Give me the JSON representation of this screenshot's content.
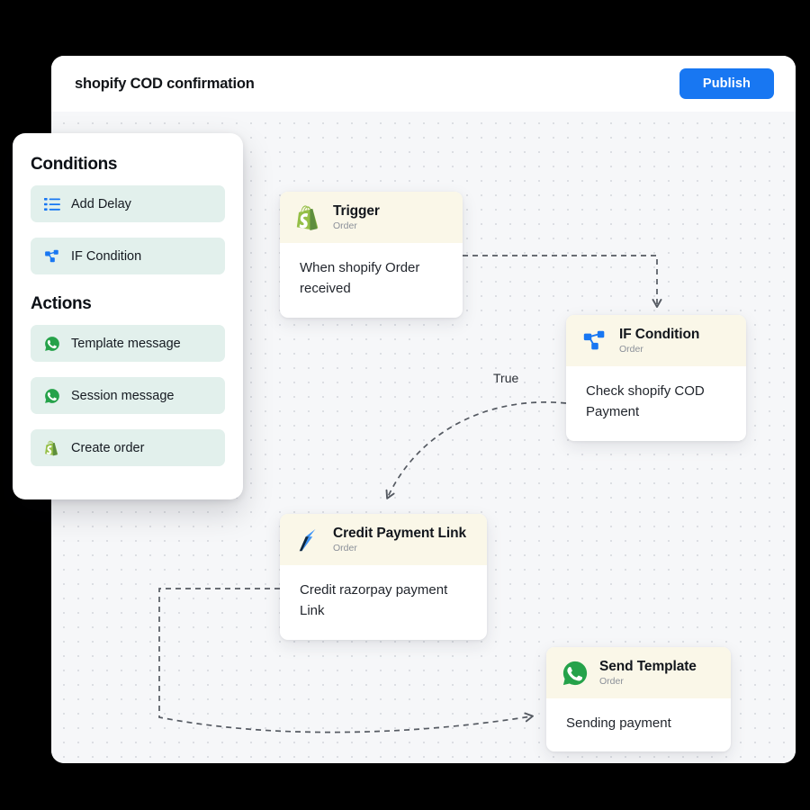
{
  "window": {
    "title": "shopify COD confirmation",
    "publish_label": "Publish"
  },
  "sidebar": {
    "sections": [
      {
        "heading": "Conditions",
        "items": [
          {
            "label": "Add Delay",
            "icon": "list-icon"
          },
          {
            "label": "IF Condition",
            "icon": "branch-icon"
          }
        ]
      },
      {
        "heading": "Actions",
        "items": [
          {
            "label": "Template message",
            "icon": "whatsapp-icon"
          },
          {
            "label": "Session message",
            "icon": "whatsapp-icon"
          },
          {
            "label": "Create order",
            "icon": "shopify-icon"
          }
        ]
      }
    ]
  },
  "flow": {
    "nodes": [
      {
        "id": "trigger",
        "title": "Trigger",
        "subtitle": "Order",
        "body": "When shopify Order received",
        "icon": "shopify-icon"
      },
      {
        "id": "if_condition",
        "title": "IF Condition",
        "subtitle": "Order",
        "body": "Check shopify COD Payment",
        "icon": "branch-icon"
      },
      {
        "id": "credit_payment_link",
        "title": "Credit Payment Link",
        "subtitle": "Order",
        "body": "Credit razorpay payment Link",
        "icon": "razorpay-icon"
      },
      {
        "id": "send_template",
        "title": "Send Template",
        "subtitle": "Order",
        "body": "Sending payment",
        "icon": "whatsapp-icon"
      }
    ],
    "edges": [
      {
        "from": "trigger",
        "to": "if_condition",
        "label": ""
      },
      {
        "from": "if_condition",
        "to": "credit_payment_link",
        "label": "True"
      },
      {
        "from": "credit_payment_link",
        "to": "send_template",
        "label": ""
      }
    ]
  },
  "colors": {
    "accent_blue": "#1877F2",
    "node_header": "#FAF7E8",
    "panel_item": "#E2F0EC",
    "canvas": "#F6F7F9",
    "edge": "#555A62",
    "whatsapp_green": "#25A24A",
    "shopify_green": "#7FB343",
    "razorpay_blue": "#3B93F7"
  }
}
